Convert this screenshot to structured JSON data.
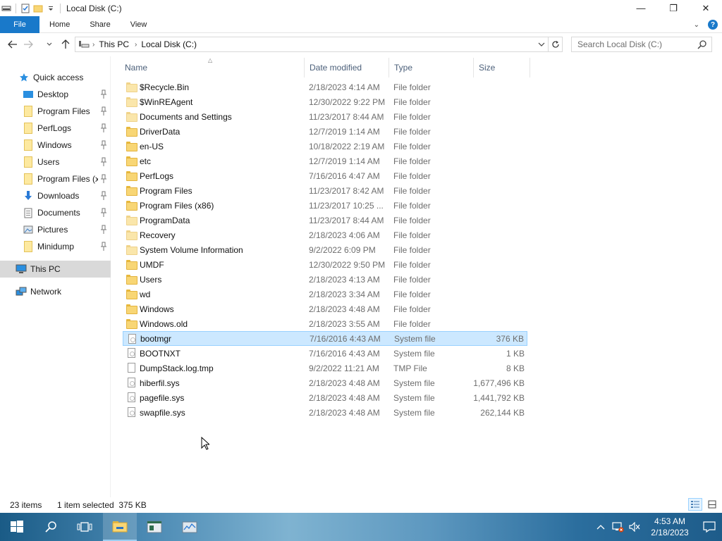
{
  "window": {
    "title": "Local Disk (C:)",
    "minimize_glyph": "—",
    "maximize_glyph": "❐",
    "close_glyph": "✕"
  },
  "ribbon": {
    "tabs": [
      "File",
      "Home",
      "Share",
      "View"
    ]
  },
  "address": {
    "crumbs": [
      "This PC",
      "Local Disk (C:)"
    ],
    "search_placeholder": "Search Local Disk (C:)"
  },
  "nav": {
    "items": [
      {
        "label": "Quick access",
        "icon": "star-icon",
        "pinned": false
      },
      {
        "label": "Desktop",
        "icon": "desktop-folder-icon",
        "pinned": true
      },
      {
        "label": "Program Files",
        "icon": "folder-icon",
        "pinned": true
      },
      {
        "label": "PerfLogs",
        "icon": "folder-icon",
        "pinned": true
      },
      {
        "label": "Windows",
        "icon": "folder-icon",
        "pinned": true
      },
      {
        "label": "Users",
        "icon": "folder-icon",
        "pinned": true
      },
      {
        "label": "Program Files (x86)",
        "icon": "folder-icon",
        "pinned": true
      },
      {
        "label": "Downloads",
        "icon": "download-icon",
        "pinned": true
      },
      {
        "label": "Documents",
        "icon": "documents-icon",
        "pinned": true
      },
      {
        "label": "Pictures",
        "icon": "pictures-icon",
        "pinned": true
      },
      {
        "label": "Minidump",
        "icon": "folder-icon",
        "pinned": true
      },
      {
        "label": "This PC",
        "icon": "computer-icon",
        "pinned": false
      },
      {
        "label": "Network",
        "icon": "network-icon",
        "pinned": false
      }
    ],
    "selected": "This PC"
  },
  "columns": {
    "name": "Name",
    "date": "Date modified",
    "type": "Type",
    "size": "Size"
  },
  "files": [
    {
      "name": "$Recycle.Bin",
      "date": "2/18/2023 4:14 AM",
      "type": "File folder",
      "size": "",
      "kind": "folder-faded"
    },
    {
      "name": "$WinREAgent",
      "date": "12/30/2022 9:22 PM",
      "type": "File folder",
      "size": "",
      "kind": "folder-faded"
    },
    {
      "name": "Documents and Settings",
      "date": "11/23/2017 8:44 AM",
      "type": "File folder",
      "size": "",
      "kind": "shortcut"
    },
    {
      "name": "DriverData",
      "date": "12/7/2019 1:14 AM",
      "type": "File folder",
      "size": "",
      "kind": "folder"
    },
    {
      "name": "en-US",
      "date": "10/18/2022 2:19 AM",
      "type": "File folder",
      "size": "",
      "kind": "folder"
    },
    {
      "name": "etc",
      "date": "12/7/2019 1:14 AM",
      "type": "File folder",
      "size": "",
      "kind": "folder"
    },
    {
      "name": "PerfLogs",
      "date": "7/16/2016 4:47 AM",
      "type": "File folder",
      "size": "",
      "kind": "folder"
    },
    {
      "name": "Program Files",
      "date": "11/23/2017 8:42 AM",
      "type": "File folder",
      "size": "",
      "kind": "folder"
    },
    {
      "name": "Program Files (x86)",
      "date": "11/23/2017 10:25 ...",
      "type": "File folder",
      "size": "",
      "kind": "folder"
    },
    {
      "name": "ProgramData",
      "date": "11/23/2017 8:44 AM",
      "type": "File folder",
      "size": "",
      "kind": "folder-faded"
    },
    {
      "name": "Recovery",
      "date": "2/18/2023 4:06 AM",
      "type": "File folder",
      "size": "",
      "kind": "folder-faded"
    },
    {
      "name": "System Volume Information",
      "date": "9/2/2022 6:09 PM",
      "type": "File folder",
      "size": "",
      "kind": "folder-faded"
    },
    {
      "name": "UMDF",
      "date": "12/30/2022 9:50 PM",
      "type": "File folder",
      "size": "",
      "kind": "folder"
    },
    {
      "name": "Users",
      "date": "2/18/2023 4:13 AM",
      "type": "File folder",
      "size": "",
      "kind": "folder"
    },
    {
      "name": "wd",
      "date": "2/18/2023 3:34 AM",
      "type": "File folder",
      "size": "",
      "kind": "folder"
    },
    {
      "name": "Windows",
      "date": "2/18/2023 4:48 AM",
      "type": "File folder",
      "size": "",
      "kind": "folder"
    },
    {
      "name": "Windows.old",
      "date": "2/18/2023 3:55 AM",
      "type": "File folder",
      "size": "",
      "kind": "folder"
    },
    {
      "name": "bootmgr",
      "date": "7/16/2016 4:43 AM",
      "type": "System file",
      "size": "376 KB",
      "kind": "sysfile"
    },
    {
      "name": "BOOTNXT",
      "date": "7/16/2016 4:43 AM",
      "type": "System file",
      "size": "1 KB",
      "kind": "sysfile"
    },
    {
      "name": "DumpStack.log.tmp",
      "date": "9/2/2022 11:21 AM",
      "type": "TMP File",
      "size": "8 KB",
      "kind": "file"
    },
    {
      "name": "hiberfil.sys",
      "date": "2/18/2023 4:48 AM",
      "type": "System file",
      "size": "1,677,496 KB",
      "kind": "sysfile"
    },
    {
      "name": "pagefile.sys",
      "date": "2/18/2023 4:48 AM",
      "type": "System file",
      "size": "1,441,792 KB",
      "kind": "sysfile"
    },
    {
      "name": "swapfile.sys",
      "date": "2/18/2023 4:48 AM",
      "type": "System file",
      "size": "262,144 KB",
      "kind": "sysfile"
    }
  ],
  "selected_file": "bootmgr",
  "status": {
    "items": "23 items",
    "selection": "1 item selected  375 KB"
  },
  "taskbar": {
    "time": "4:53 AM",
    "date": "2/18/2023"
  },
  "colors": {
    "accent": "#1979ca",
    "selection_bg": "#cce8ff",
    "selection_border": "#99d1ff",
    "nav_selected": "#d9d9d9",
    "folder": "#f8d675"
  }
}
